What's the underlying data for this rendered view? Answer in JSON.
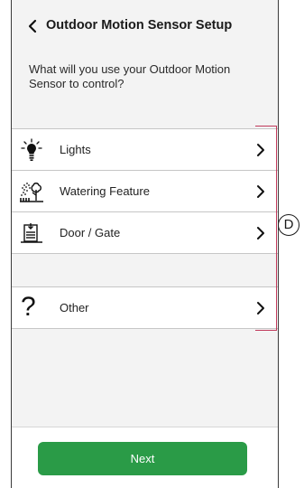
{
  "header": {
    "back_icon": "chevron-left-icon",
    "title": "Outdoor Motion Sensor Setup"
  },
  "question": "What will you use your Outdoor Motion Sensor to control?",
  "options": [
    {
      "label": "Lights",
      "icon": "light-bulb-icon"
    },
    {
      "label": "Watering Feature",
      "icon": "watering-icon"
    },
    {
      "label": "Door / Gate",
      "icon": "gate-icon"
    },
    {
      "label": "Other",
      "icon": "question-mark-icon"
    }
  ],
  "footer": {
    "next_label": "Next"
  },
  "annotation": {
    "callout_label": "D"
  },
  "colors": {
    "accent": "#2a9b47",
    "bracket": "#c0395a",
    "background": "#f3f3f3"
  }
}
